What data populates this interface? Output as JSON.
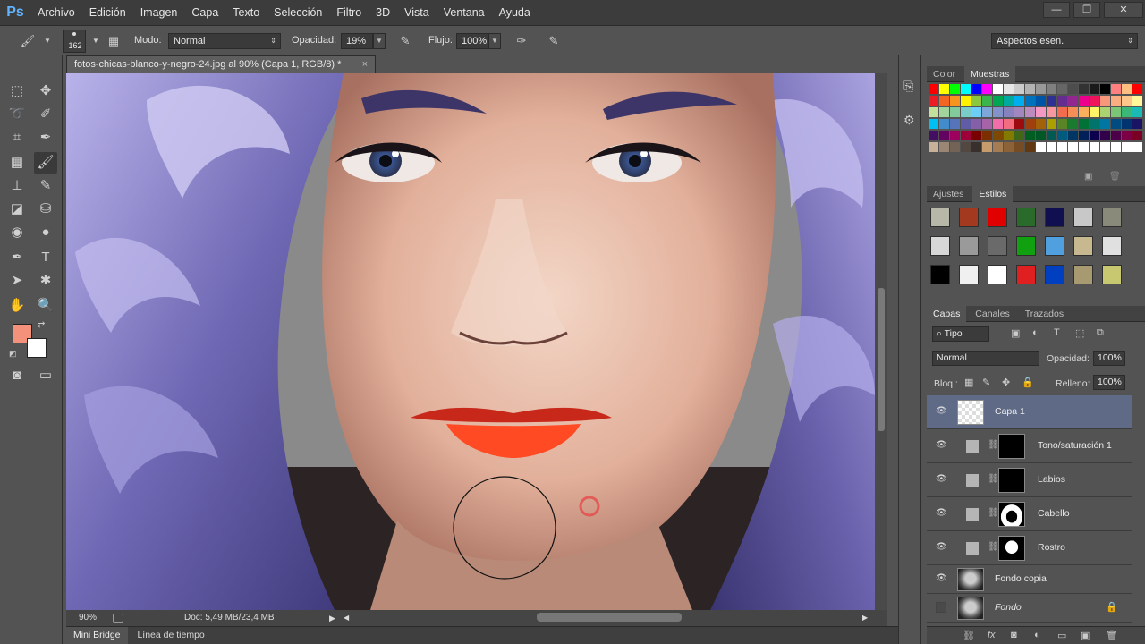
{
  "menubar": {
    "logo": "Ps",
    "items": [
      "Archivo",
      "Edición",
      "Imagen",
      "Capa",
      "Texto",
      "Selección",
      "Filtro",
      "3D",
      "Vista",
      "Ventana",
      "Ayuda"
    ]
  },
  "options": {
    "brush_size": "162",
    "mode_label": "Modo:",
    "mode_value": "Normal",
    "opacity_label": "Opacidad:",
    "opacity_value": "19%",
    "flow_label": "Flujo:",
    "flow_value": "100%",
    "workspace": "Aspectos esen."
  },
  "document": {
    "tab_title": "fotos-chicas-blanco-y-negro-24.jpg al 90% (Capa 1, RGB/8) *",
    "close_glyph": "×"
  },
  "status": {
    "zoom": "90%",
    "doc_size": "Doc: 5,49 MB/23,4 MB"
  },
  "bottom_tabs": [
    "Mini Bridge",
    "Línea de tiempo"
  ],
  "color_panel": {
    "tabs": [
      "Color",
      "Muestras"
    ],
    "active_tab": "Muestras"
  },
  "styles_panel": {
    "tabs": [
      "Ajustes",
      "Estilos"
    ],
    "active_tab": "Estilos"
  },
  "layers_panel": {
    "tabs": [
      "Capas",
      "Canales",
      "Trazados"
    ],
    "active_tab": "Capas",
    "filter": "Tipo",
    "blend_mode": "Normal",
    "opacity_label": "Opacidad:",
    "opacity_value": "100%",
    "lock_label": "Bloq.:",
    "fill_label": "Relleno:",
    "fill_value": "100%",
    "layers": [
      {
        "name": "Capa 1",
        "selected": true
      },
      {
        "name": "Tono/saturación 1"
      },
      {
        "name": "Labios"
      },
      {
        "name": "Cabello"
      },
      {
        "name": "Rostro"
      },
      {
        "name": "Fondo copia"
      },
      {
        "name": "Fondo"
      }
    ]
  },
  "colors": {
    "foreground": "#f4917b",
    "background": "#ffffff",
    "selected_layer": "#5f6a86"
  }
}
